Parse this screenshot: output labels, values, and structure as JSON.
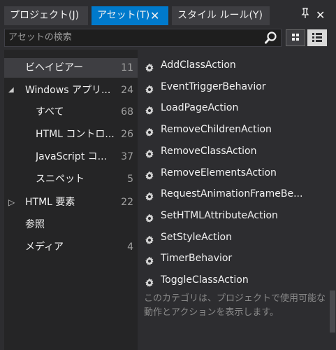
{
  "tabs": [
    {
      "label": "プロジェクト(J)",
      "active": false
    },
    {
      "label": "アセット(T)",
      "active": true
    },
    {
      "label": "スタイル ルール(Y)",
      "active": false
    }
  ],
  "tab_close_glyph": "✕",
  "panel_tools": {
    "pin_glyph": "⊥",
    "close_glyph": "✕"
  },
  "search": {
    "placeholder": "アセットの検索",
    "value": ""
  },
  "view_modes": [
    "grid-view",
    "list-view"
  ],
  "tree": [
    {
      "label": "ビヘイビアー",
      "count": "11",
      "selected": true,
      "toggle": ""
    },
    {
      "label": "Windows アプリ...",
      "count": "24",
      "toggle": "◢"
    },
    {
      "label": "すべて",
      "count": "68",
      "toggle": ""
    },
    {
      "label": "HTML コントロ...",
      "count": "26",
      "toggle": ""
    },
    {
      "label": "JavaScript コ...",
      "count": "37",
      "toggle": ""
    },
    {
      "label": "スニペット",
      "count": "5",
      "toggle": ""
    },
    {
      "label": "HTML 要素",
      "count": "22",
      "toggle": "▷"
    },
    {
      "label": "参照",
      "count": "",
      "toggle": ""
    },
    {
      "label": "メディア",
      "count": "4",
      "toggle": ""
    }
  ],
  "items": [
    {
      "label": "AddClassAction"
    },
    {
      "label": "EventTriggerBehavior"
    },
    {
      "label": "LoadPageAction"
    },
    {
      "label": "RemoveChildrenAction"
    },
    {
      "label": "RemoveClassAction"
    },
    {
      "label": "RemoveElementsAction"
    },
    {
      "label": "RequestAnimationFrameBe..."
    },
    {
      "label": "SetHTMLAttributeAction"
    },
    {
      "label": "SetStyleAction"
    },
    {
      "label": "TimerBehavior"
    },
    {
      "label": "ToggleClassAction"
    }
  ],
  "description": "このカテゴリは、プロジェクトで使用可能な動作とアクションを表示します。",
  "colors": {
    "accent": "#007acc",
    "background": "#2d2d30",
    "tree_background": "#252526",
    "selection": "#3e3e42"
  }
}
